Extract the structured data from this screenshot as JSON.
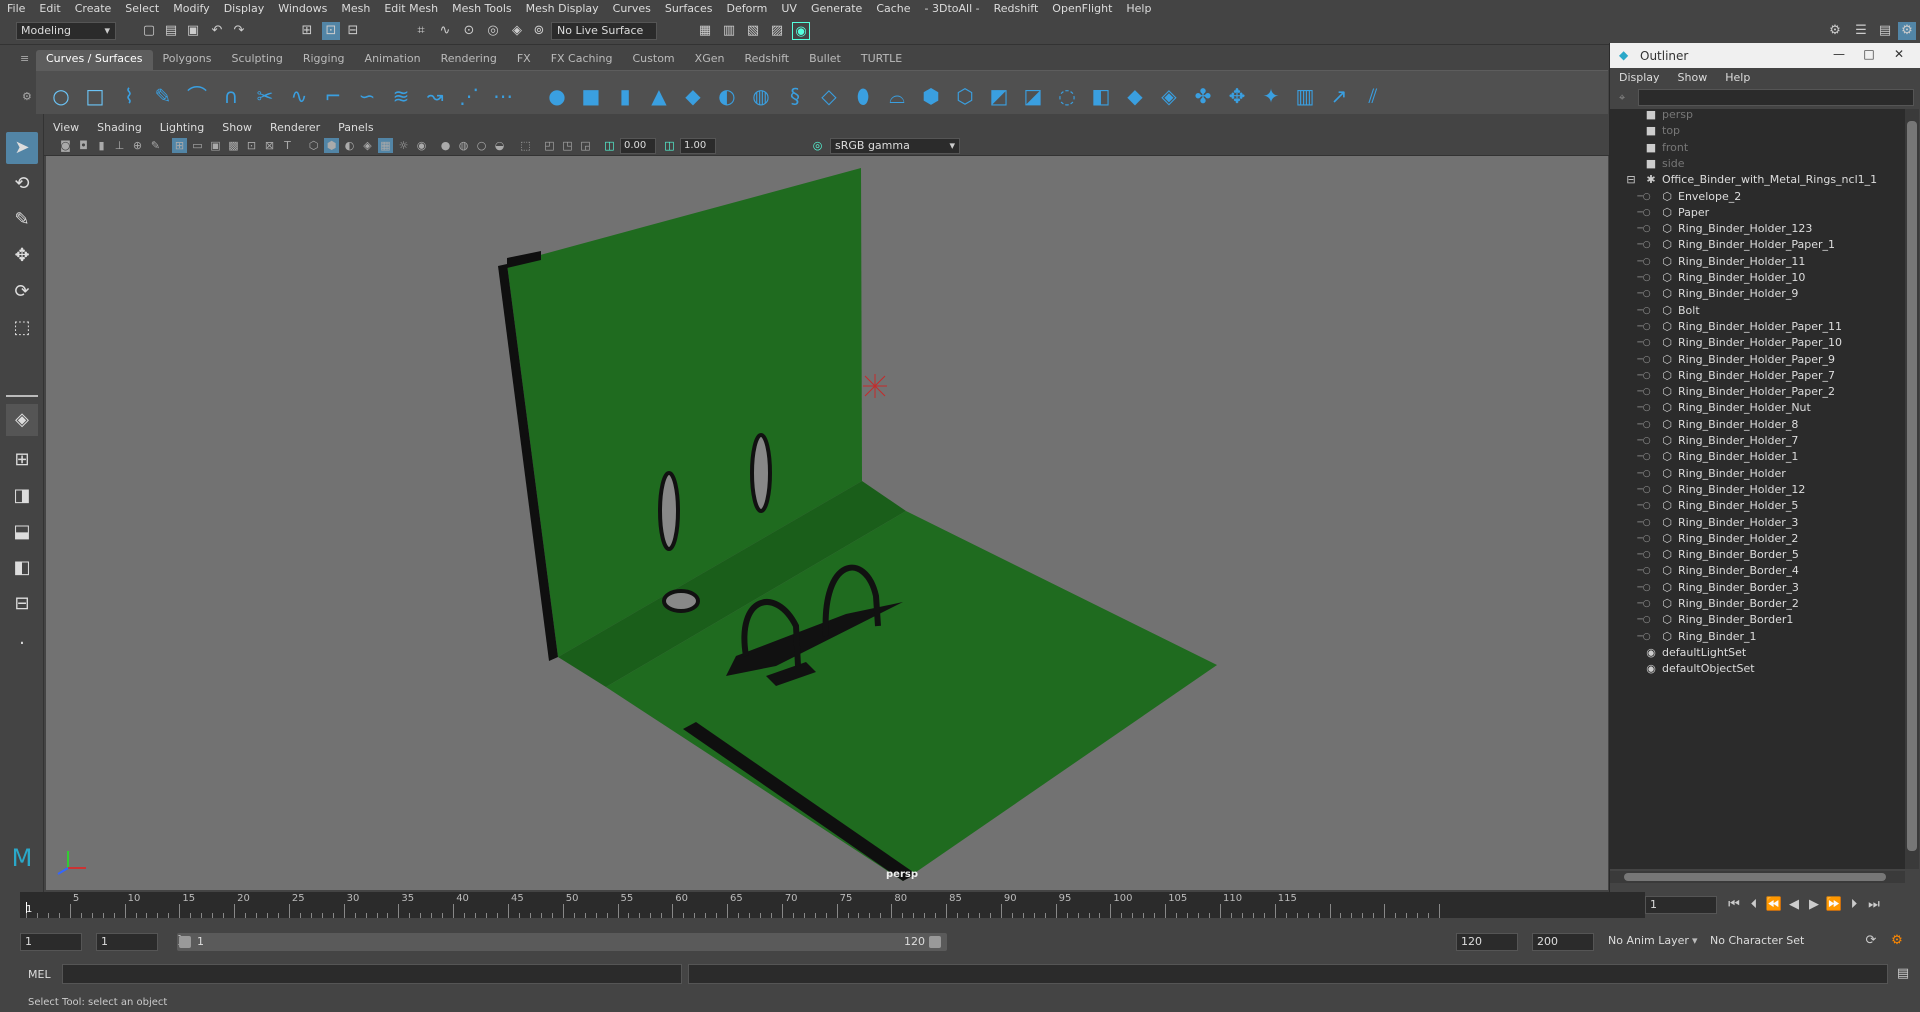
{
  "menubar": {
    "items": [
      "File",
      "Edit",
      "Create",
      "Select",
      "Modify",
      "Display",
      "Windows",
      "Mesh",
      "Edit Mesh",
      "Mesh Tools",
      "Mesh Display",
      "Curves",
      "Surfaces",
      "Deform",
      "UV",
      "Generate",
      "Cache",
      "- 3DtoAll -",
      "Redshift",
      "OpenFlight",
      "Help"
    ]
  },
  "statusline": {
    "mode": "Modeling",
    "live_surface": "No Live Surface"
  },
  "shelf": {
    "tabs": [
      "Curves / Surfaces",
      "Polygons",
      "Sculpting",
      "Rigging",
      "Animation",
      "Rendering",
      "FX",
      "FX Caching",
      "Custom",
      "XGen",
      "Redshift",
      "Bullet",
      "TURTLE"
    ],
    "active_tab": "Curves / Surfaces"
  },
  "panel": {
    "menu": [
      "View",
      "Shading",
      "Lighting",
      "Show",
      "Renderer",
      "Panels"
    ],
    "exposure": "0.00",
    "gamma_value": "1.00",
    "color_space": "sRGB gamma",
    "camera_label": "persp"
  },
  "outliner": {
    "title": "Outliner",
    "menu": [
      "Display",
      "Show",
      "Help"
    ],
    "cameras": [
      "persp",
      "top",
      "front",
      "side"
    ],
    "group": "Office_Binder_with_Metal_Rings_ncl1_1",
    "children": [
      "Envelope_2",
      "Paper",
      "Ring_Binder_Holder_123",
      "Ring_Binder_Holder_Paper_1",
      "Ring_Binder_Holder_11",
      "Ring_Binder_Holder_10",
      "Ring_Binder_Holder_9",
      "Bolt",
      "Ring_Binder_Holder_Paper_11",
      "Ring_Binder_Holder_Paper_10",
      "Ring_Binder_Holder_Paper_9",
      "Ring_Binder_Holder_Paper_7",
      "Ring_Binder_Holder_Paper_2",
      "Ring_Binder_Holder_Nut",
      "Ring_Binder_Holder_8",
      "Ring_Binder_Holder_7",
      "Ring_Binder_Holder_1",
      "Ring_Binder_Holder",
      "Ring_Binder_Holder_12",
      "Ring_Binder_Holder_5",
      "Ring_Binder_Holder_3",
      "Ring_Binder_Holder_2",
      "Ring_Binder_Border_5",
      "Ring_Binder_Border_4",
      "Ring_Binder_Border_3",
      "Ring_Binder_Border_2",
      "Ring_Binder_Border1",
      "Ring_Binder_1"
    ],
    "sets": [
      "defaultLightSet",
      "defaultObjectSet"
    ]
  },
  "timeline": {
    "ticks": [
      "5",
      "10",
      "15",
      "20",
      "25",
      "30",
      "35",
      "40",
      "45",
      "50",
      "55",
      "60",
      "65",
      "70",
      "75",
      "80",
      "85",
      "90",
      "95",
      "100",
      "105",
      "110",
      "115"
    ],
    "start_marker": "1",
    "current_frame": "1"
  },
  "range": {
    "start": "1",
    "start2": "1",
    "slider_start": "1",
    "slider_end": "120",
    "end": "120",
    "end2": "200",
    "anim_layer": "No Anim Layer",
    "character_set": "No Character Set"
  },
  "mel": {
    "label": "MEL"
  },
  "help": {
    "text": "Select Tool: select an object"
  }
}
